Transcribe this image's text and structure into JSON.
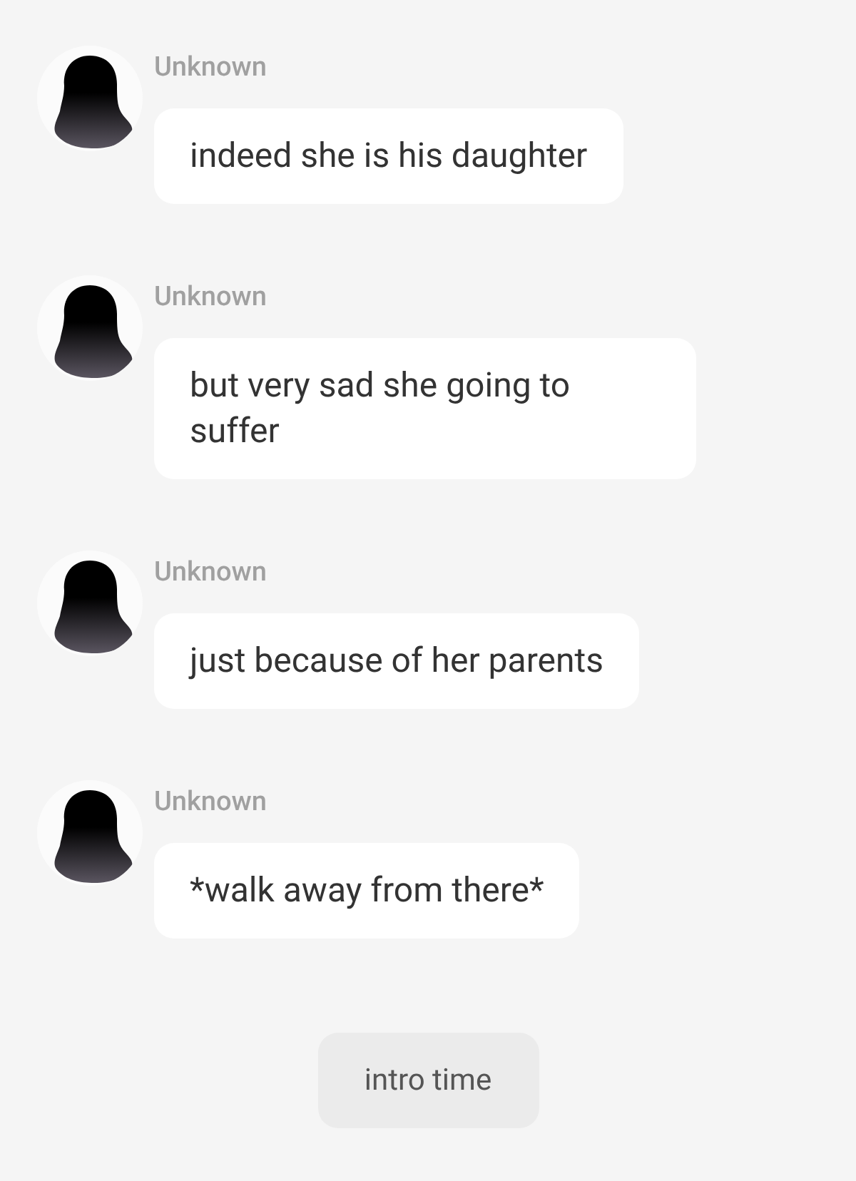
{
  "messages": [
    {
      "sender": "Unknown",
      "text": "indeed she is his daughter"
    },
    {
      "sender": "Unknown",
      "text": "but very sad she going to suffer"
    },
    {
      "sender": "Unknown",
      "text": "just because of her parents"
    },
    {
      "sender": "Unknown",
      "text": "*walk away from there*"
    }
  ],
  "suggestion_button": {
    "label": "intro time"
  }
}
